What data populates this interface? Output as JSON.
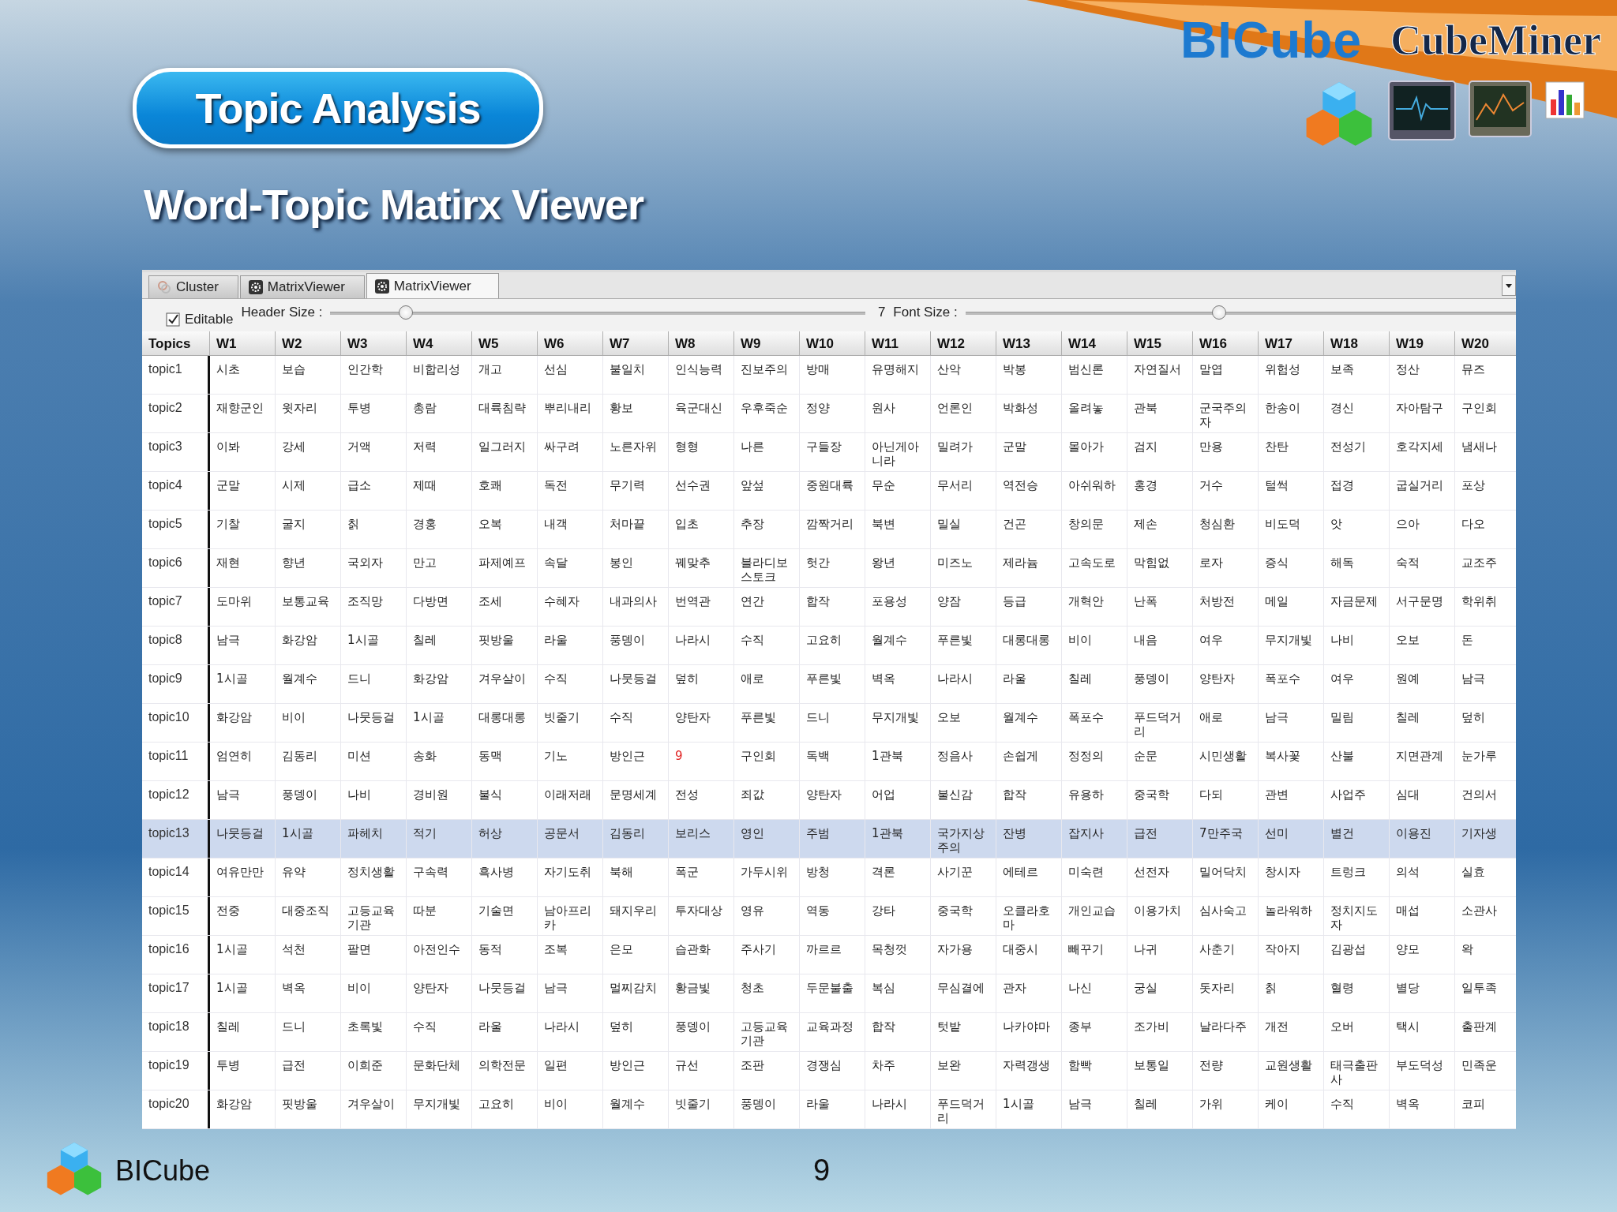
{
  "slide": {
    "title": "Topic Analysis",
    "subtitle": "Word-Topic Matirx Viewer",
    "brand": "BICube",
    "product": "CubeMiner",
    "footer_brand": "BICube",
    "page_number": "9"
  },
  "app": {
    "tabs": [
      {
        "label": "Cluster",
        "kind": "cluster",
        "selected": false
      },
      {
        "label": "MatrixViewer",
        "kind": "matrix",
        "selected": false
      },
      {
        "label": "MatrixViewer",
        "kind": "matrix",
        "selected": true
      }
    ],
    "editable": {
      "label": "Editable",
      "checked": true
    },
    "header_size": {
      "label": "Header Size :",
      "level": 0.14
    },
    "value_label": "7",
    "font_size": {
      "label": "Font Size :",
      "level": 0.46
    },
    "table": {
      "columns": [
        "Topics",
        "W1",
        "W2",
        "W3",
        "W4",
        "W5",
        "W6",
        "W7",
        "W8",
        "W9",
        "W10",
        "W11",
        "W12",
        "W13",
        "W14",
        "W15",
        "W16",
        "W17",
        "W18",
        "W19",
        "W20"
      ],
      "rows": [
        {
          "selected": false,
          "cells": [
            "topic1",
            "시초",
            "보습",
            "인간학",
            "비합리성",
            "개고",
            "선심",
            "불일치",
            "인식능력",
            "진보주의",
            "방매",
            "유명해지",
            "산악",
            "박봉",
            "범신론",
            "자연질서",
            "말엽",
            "위험성",
            "보족",
            "정산",
            "뮤즈"
          ]
        },
        {
          "selected": false,
          "cells": [
            "topic2",
            "재향군인",
            "윗자리",
            "투병",
            "총람",
            "대륙침략",
            "뿌리내리",
            "황보",
            "육군대신",
            "우후죽순",
            "정양",
            "원사",
            "언론인",
            "박화성",
            "올려놓",
            "관북",
            "군국주의자",
            "한송이",
            "경신",
            "자아탐구",
            "구인회"
          ]
        },
        {
          "selected": false,
          "cells": [
            "topic3",
            "이봐",
            "강세",
            "거액",
            "저력",
            "일그러지",
            "싸구려",
            "노른자위",
            "형형",
            "나른",
            "구들장",
            "아닌게아니라",
            "밀려가",
            "군말",
            "몰아가",
            "검지",
            "만용",
            "찬탄",
            "전성기",
            "호각지세",
            "냄새나"
          ]
        },
        {
          "selected": false,
          "cells": [
            "topic4",
            "군말",
            "시제",
            "급소",
            "제때",
            "호쾌",
            "독전",
            "무기력",
            "선수권",
            "앞섶",
            "중원대륙",
            "무순",
            "무서리",
            "역전승",
            "아쉬워하",
            "홍경",
            "거수",
            "털썩",
            "접경",
            "굽실거리",
            "포상"
          ]
        },
        {
          "selected": false,
          "cells": [
            "topic5",
            "기찰",
            "굴지",
            "칡",
            "경홍",
            "오복",
            "내객",
            "처마끝",
            "입초",
            "추장",
            "깜짝거리",
            "북변",
            "밀실",
            "건곤",
            "창의문",
            "제손",
            "청심환",
            "비도덕",
            "앗",
            "으아",
            "다오"
          ]
        },
        {
          "selected": false,
          "cells": [
            "topic6",
            "재현",
            "향년",
            "국외자",
            "만고",
            "파제예프",
            "속달",
            "봉인",
            "꿰맞추",
            "블라디보스토크",
            "헛간",
            "왕년",
            "미즈노",
            "제라늄",
            "고속도로",
            "막힘없",
            "로자",
            "증식",
            "해독",
            "숙적",
            "교조주"
          ]
        },
        {
          "selected": false,
          "cells": [
            "topic7",
            "도마위",
            "보통교육",
            "조직망",
            "다방면",
            "조세",
            "수혜자",
            "내과의사",
            "번역관",
            "연간",
            "합작",
            "포용성",
            "양잠",
            "등급",
            "개혁안",
            "난폭",
            "처방전",
            "메일",
            "자금문제",
            "서구문명",
            "학위취"
          ]
        },
        {
          "selected": false,
          "cells": [
            "topic8",
            "남극",
            "화강암",
            "1시골",
            "칠레",
            "핏방울",
            "라울",
            "풍뎅이",
            "나라시",
            "수직",
            "고요히",
            "월계수",
            "푸른빛",
            "대롱대롱",
            "비이",
            "내음",
            "여우",
            "무지개빛",
            "나비",
            "오보",
            "돈"
          ]
        },
        {
          "selected": false,
          "cells": [
            "topic9",
            "1시골",
            "월계수",
            "드니",
            "화강암",
            "겨우살이",
            "수직",
            "나뭇등걸",
            "덮히",
            "애로",
            "푸른빛",
            "벽옥",
            "나라시",
            "라울",
            "칠레",
            "풍뎅이",
            "양탄자",
            "폭포수",
            "여우",
            "원예",
            "남극"
          ]
        },
        {
          "selected": false,
          "cells": [
            "topic10",
            "화강암",
            "비이",
            "나뭇등걸",
            "1시골",
            "대롱대롱",
            "빗줄기",
            "수직",
            "양탄자",
            "푸른빛",
            "드니",
            "무지개빛",
            "오보",
            "월계수",
            "폭포수",
            "푸드덕거리",
            "애로",
            "남극",
            "밀림",
            "칠레",
            "덮히"
          ]
        },
        {
          "selected": false,
          "cells": [
            "topic11",
            "엄연히",
            "김동리",
            "미션",
            "송화",
            "동맥",
            "기노",
            "방인근",
            {
              "text": "9",
              "color": "#e02020"
            },
            "구인회",
            "독백",
            "1관북",
            "정음사",
            "손쉽게",
            "정정의",
            "순문",
            "시민생활",
            "복사꽃",
            "산불",
            "지면관계",
            "눈가루"
          ]
        },
        {
          "selected": false,
          "cells": [
            "topic12",
            "남극",
            "풍뎅이",
            "나비",
            "경비원",
            "불식",
            "이래저래",
            "문명세계",
            "전성",
            "죄값",
            "양탄자",
            "어업",
            "불신감",
            "합작",
            "유용하",
            "중국학",
            "다되",
            "관변",
            "사업주",
            "심대",
            "건의서"
          ]
        },
        {
          "selected": true,
          "cells": [
            "topic13",
            "나뭇등걸",
            "1시골",
            "파헤치",
            "적기",
            "허상",
            "공문서",
            "김동리",
            "보리스",
            "영인",
            "주범",
            "1관북",
            "국가지상주의",
            "잔병",
            "잡지사",
            "급전",
            "7만주국",
            "선미",
            "별건",
            "이용진",
            "기자생"
          ]
        },
        {
          "selected": false,
          "cells": [
            "topic14",
            "여유만만",
            "유약",
            "정치생활",
            "구속력",
            "흑사병",
            "자기도취",
            "북해",
            "폭군",
            "가두시위",
            "방청",
            "격론",
            "사기꾼",
            "에테르",
            "미숙련",
            "선전자",
            "밀어닥치",
            "창시자",
            "트렁크",
            "의석",
            "실효"
          ]
        },
        {
          "selected": false,
          "cells": [
            "topic15",
            "전중",
            "대중조직",
            "고등교육기관",
            "따분",
            "기술면",
            "남아프리카",
            "돼지우리",
            "투자대상",
            "영유",
            "역동",
            "강타",
            "중국학",
            "오클라호마",
            "개인교습",
            "이용가치",
            "심사숙고",
            "놀라워하",
            "정치지도자",
            "매섭",
            "소관사"
          ]
        },
        {
          "selected": false,
          "cells": [
            "topic16",
            "1시골",
            "석천",
            "팔면",
            "아전인수",
            "동적",
            "조복",
            "은모",
            "습관화",
            "주사기",
            "까르르",
            "목청껏",
            "자가용",
            "대중시",
            "빼꾸기",
            "나귀",
            "사춘기",
            "작아지",
            "김광섭",
            "양모",
            "왁"
          ]
        },
        {
          "selected": false,
          "cells": [
            "topic17",
            "1시골",
            "벽옥",
            "비이",
            "양탄자",
            "나뭇등걸",
            "남극",
            "멀찌감치",
            "황금빛",
            "청초",
            "두문불출",
            "복심",
            "무심결에",
            "관자",
            "나신",
            "궁실",
            "돗자리",
            "칡",
            "혈령",
            "별당",
            "일투족"
          ]
        },
        {
          "selected": false,
          "cells": [
            "topic18",
            "칠레",
            "드니",
            "초록빛",
            "수직",
            "라울",
            "나라시",
            "덮히",
            "풍뎅이",
            "고등교육기관",
            "교육과정",
            "합작",
            "텃밭",
            "나카야마",
            "종부",
            "조가비",
            "날라다주",
            "개전",
            "오버",
            "택시",
            "출판계"
          ]
        },
        {
          "selected": false,
          "cells": [
            "topic19",
            "투병",
            "급전",
            "이희준",
            "문화단체",
            "의학전문",
            "일편",
            "방인근",
            "규선",
            "조판",
            "경쟁심",
            "차주",
            "보완",
            "자력갱생",
            "함빡",
            "보통일",
            "전량",
            "교원생활",
            "태극출판사",
            "부도덕성",
            "민족운"
          ]
        },
        {
          "selected": false,
          "cells": [
            "topic20",
            "화강암",
            "핏방울",
            "겨우살이",
            "무지개빛",
            "고요히",
            "비이",
            "월계수",
            "빗줄기",
            "풍뎅이",
            "라울",
            "나라시",
            "푸드덕거리",
            "1시골",
            "남극",
            "칠레",
            "가위",
            "케이",
            "수직",
            "벽옥",
            "코피"
          ]
        }
      ]
    }
  }
}
